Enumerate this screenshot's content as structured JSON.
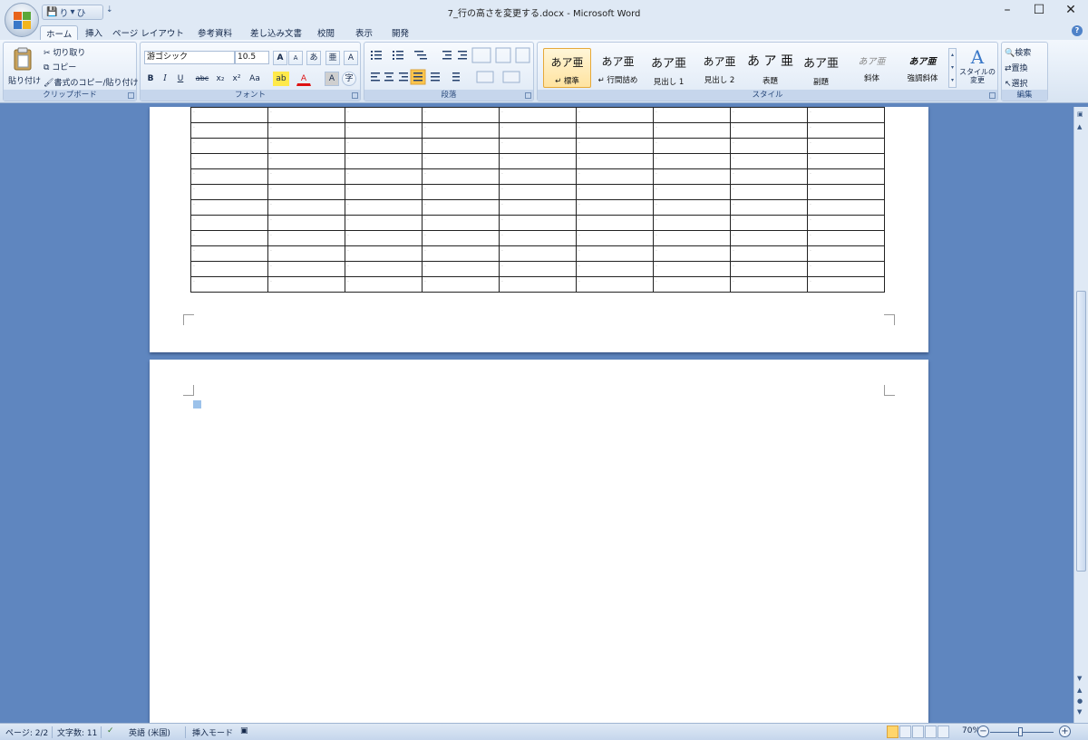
{
  "window": {
    "title": "7_行の高さを変更する.docx - Microsoft Word",
    "minimize": "–",
    "maximize": "☐",
    "close": "✕"
  },
  "qat": {
    "save": "💾",
    "undo": "り",
    "undo_arrow": "▾",
    "redo": "ひ",
    "more": "⇣"
  },
  "tabs": [
    {
      "label": "ホーム",
      "active": true
    },
    {
      "label": "挿入"
    },
    {
      "label": "ページ レイアウト"
    },
    {
      "label": "参考資料"
    },
    {
      "label": "差し込み文書"
    },
    {
      "label": "校閲"
    },
    {
      "label": "表示"
    },
    {
      "label": "開発"
    }
  ],
  "clipboard": {
    "label": "クリップボード",
    "paste": "貼り付け",
    "cut": "切り取り",
    "copy": "コピー",
    "format_painter": "書式のコピー/貼り付け"
  },
  "font": {
    "label": "フォント",
    "name": "游ゴシック",
    "size": "10.5",
    "bold": "B",
    "italic": "I",
    "underline": "U",
    "strike": "abc",
    "subscript": "x₂",
    "superscript": "x²",
    "case": "Aa",
    "grow": "A",
    "shrink": "A",
    "clear": "あ",
    "phonetic": "亜",
    "border_char": "A",
    "highlight": "ab",
    "color": "A",
    "shade": "A",
    "enclose": "字"
  },
  "paragraph": {
    "label": "段落"
  },
  "styles": {
    "label": "スタイル",
    "items": [
      {
        "sample": "あア亜",
        "name": "↵ 標準",
        "selected": true
      },
      {
        "sample": "あア亜",
        "name": "↵ 行間詰め"
      },
      {
        "sample": "あア亜",
        "name": "見出し 1"
      },
      {
        "sample": "あア亜",
        "name": "見出し 2"
      },
      {
        "sample": "あ ア 亜",
        "name": "表題"
      },
      {
        "sample": "あア亜",
        "name": "副題"
      },
      {
        "sample": "あア亜",
        "name": "斜体"
      },
      {
        "sample": "あア亜",
        "name": "強調斜体"
      }
    ],
    "change": "スタイルの変更"
  },
  "editing": {
    "label": "編集",
    "find": "検索",
    "replace": "置換",
    "select": "選択"
  },
  "table": {
    "rows": 12,
    "cols": 9,
    "cell_mark": "."
  },
  "status": {
    "page": "ページ: 2/2",
    "words": "文字数: 11",
    "lang": "英語 (米国)",
    "mode": "挿入モード",
    "zoom": "70%"
  }
}
